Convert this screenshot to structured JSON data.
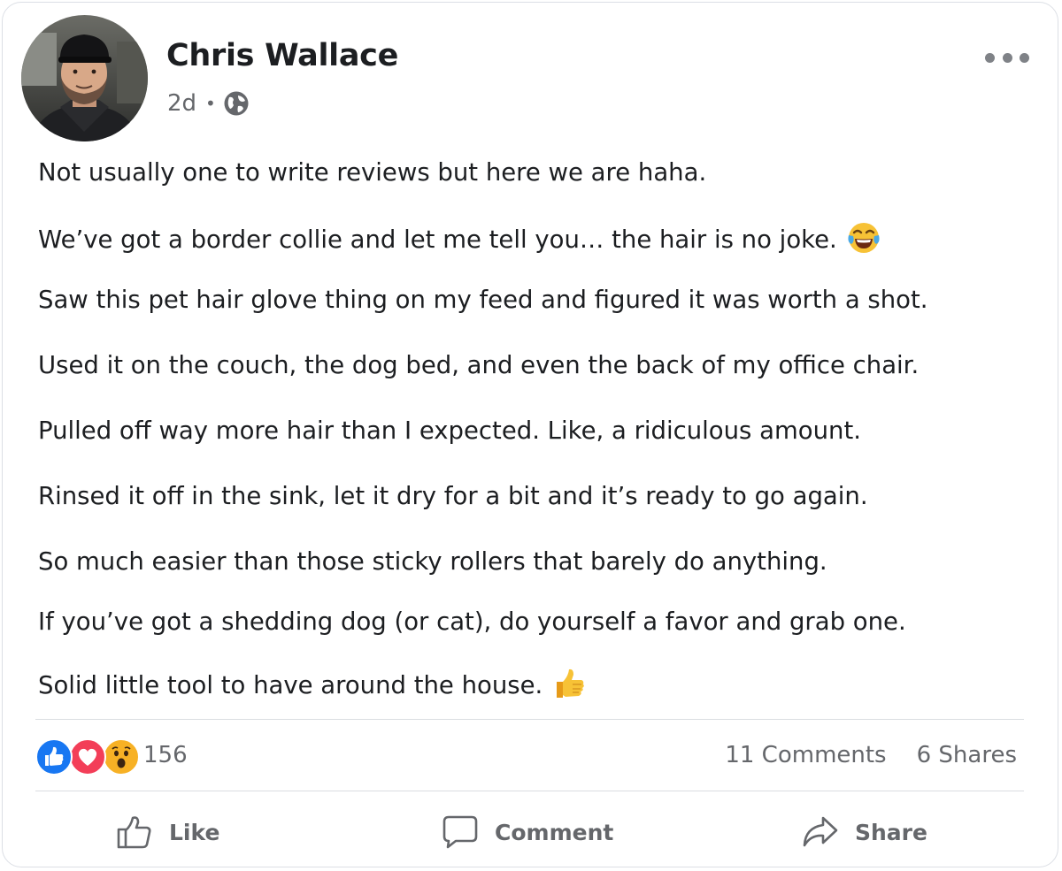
{
  "post": {
    "author": "Chris Wallace",
    "time": "2d",
    "privacy_icon": "globe-icon",
    "lines": [
      "Not usually one to write reviews but here we are haha.",
      "We’ve got a border collie and let me tell you… the hair is no joke.",
      "Saw this pet hair glove thing on my feed and figured it was worth a shot.",
      "Used it on the couch, the dog bed, and even the back of my office chair.",
      "Pulled off way more hair than I expected. Like, a ridiculous amount.",
      "Rinsed it off in the sink, let it dry for a bit and it’s ready to go again.",
      "So much easier than those sticky rollers that barely do anything.",
      "If you’ve got a shedding dog (or cat), do yourself a favor and grab one.",
      "Solid little tool to have around the house."
    ],
    "emojis": [
      "tears-of-joy-emoji",
      "thumbs-up-emoji"
    ]
  },
  "reactions": {
    "icons": [
      "like-reaction-icon",
      "love-reaction-icon",
      "wow-reaction-icon"
    ],
    "count": "156",
    "comments": "11 Comments",
    "shares": "6 Shares"
  },
  "actions": {
    "like": "Like",
    "comment": "Comment",
    "share": "Share"
  },
  "colors": {
    "like_blue": "#1877f2",
    "love_red": "#f33e58",
    "wow_yellow": "#f7b125",
    "text_primary": "#1c1e21",
    "text_secondary": "#65676b"
  }
}
